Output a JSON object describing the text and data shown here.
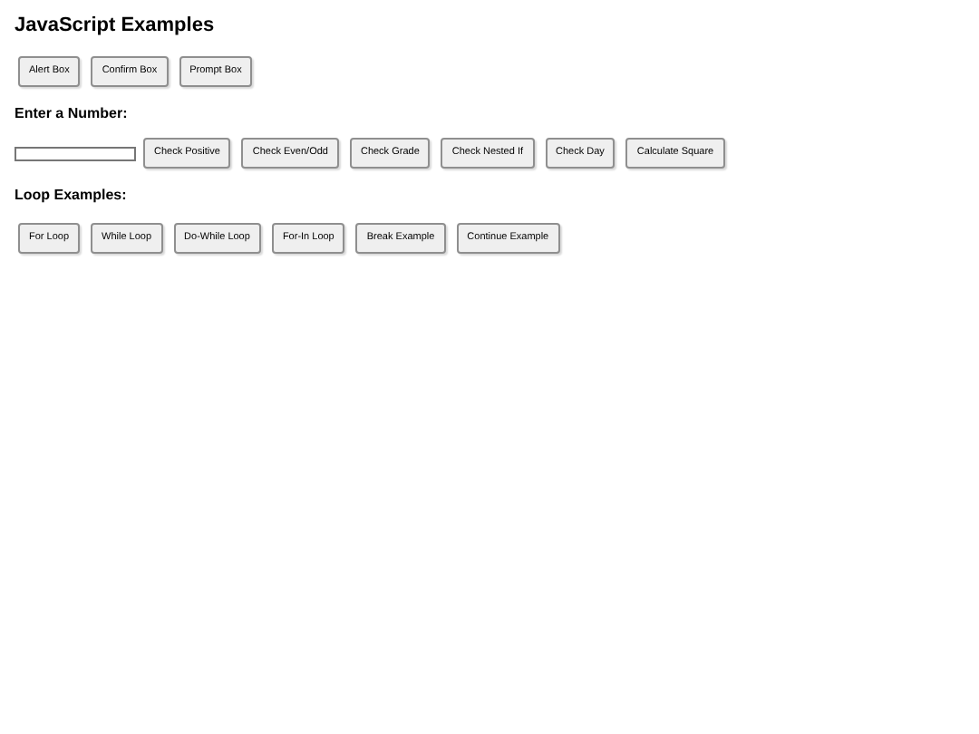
{
  "title": "JavaScript Examples",
  "dialog_buttons": [
    "Alert Box",
    "Confirm Box",
    "Prompt Box"
  ],
  "number_section": {
    "heading": "Enter a Number:",
    "buttons": [
      "Check Positive",
      "Check Even/Odd",
      "Check Grade",
      "Check Nested If",
      "Check Day",
      "Calculate Square"
    ]
  },
  "loop_section": {
    "heading": "Loop Examples:",
    "buttons": [
      "For Loop",
      "While Loop",
      "Do-While Loop",
      "For-In Loop",
      "Break Example",
      "Continue Example"
    ]
  }
}
